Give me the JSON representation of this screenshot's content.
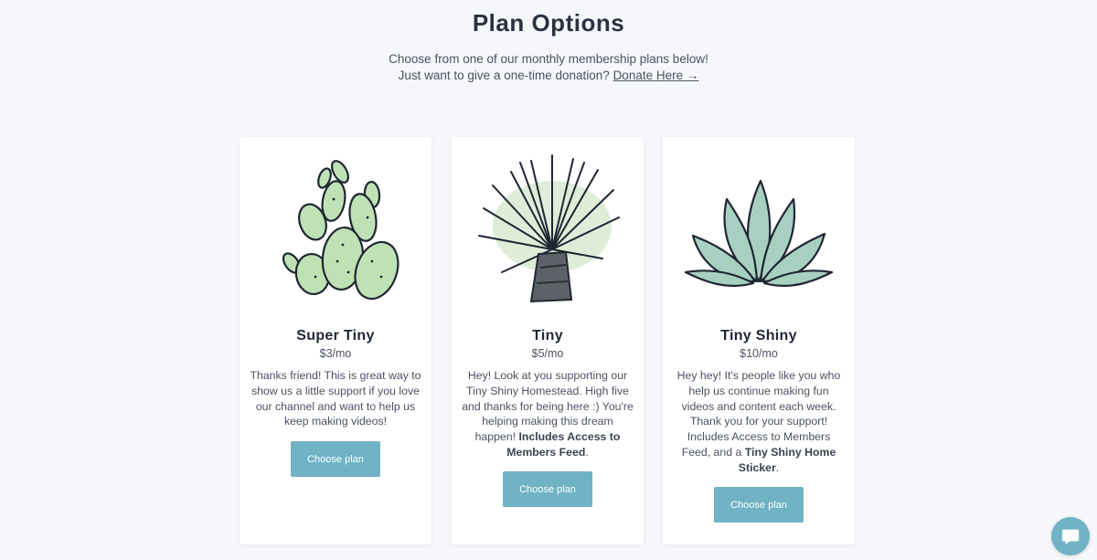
{
  "header": {
    "title": "Plan Options",
    "subtitle_line1": "Choose from one of our monthly membership plans below!",
    "subtitle_line2": "Just want to give a one-time donation?",
    "donate_link": "Donate Here →"
  },
  "plans": [
    {
      "name": "Super Tiny",
      "price": "$3/mo",
      "description": [
        {
          "text": "Thanks friend! This is great way to show us a little support if you love our channel and want to help us keep making videos!",
          "bold": false
        }
      ],
      "button": "Choose plan",
      "icon": "prickly-pear-cactus-illustration"
    },
    {
      "name": "Tiny",
      "price": "$5/mo",
      "description": [
        {
          "text": "Hey! Look at you supporting our Tiny Shiny Homestead. High five and thanks for being here :) You're helping making this dream happen! ",
          "bold": false
        },
        {
          "text": "Includes Access to Members Feed",
          "bold": true
        },
        {
          "text": ".",
          "bold": false
        }
      ],
      "button": "Choose plan",
      "icon": "yucca-plant-illustration"
    },
    {
      "name": "Tiny Shiny",
      "price": "$10/mo",
      "description": [
        {
          "text": "Hey hey! It's people like you who help us continue making fun videos and content each week. Thank you for your support! Includes Access to Members Feed, and a ",
          "bold": false
        },
        {
          "text": "Tiny Shiny Home Sticker",
          "bold": true
        },
        {
          "text": ".",
          "bold": false
        }
      ],
      "button": "Choose plan",
      "icon": "agave-plant-illustration"
    }
  ],
  "chat": {
    "icon": "chat-bubble-icon"
  },
  "colors": {
    "background": "#f5f7fb",
    "button": "#6fb3c5",
    "heading": "#1f2633",
    "plant_green": "#a9d5a3"
  }
}
